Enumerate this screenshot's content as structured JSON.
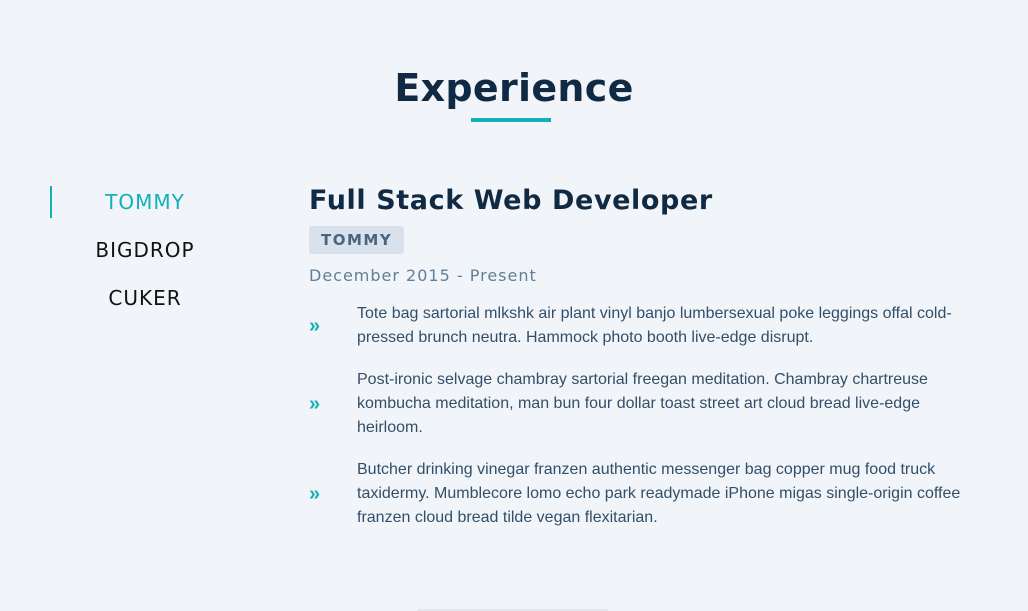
{
  "section": {
    "title": "Experience"
  },
  "tabs": [
    {
      "label": "TOMMY",
      "active": true
    },
    {
      "label": "BIGDROP",
      "active": false
    },
    {
      "label": "CUKER",
      "active": false
    }
  ],
  "job": {
    "title": "Full Stack Web Developer",
    "company": "TOMMY",
    "dates": "December 2015 - Present",
    "duty_icon": "double-chevron-right-icon",
    "duties": [
      "Tote bag sartorial mlkshk air plant vinyl banjo lumbersexual poke leggings offal cold-pressed brunch neutra. Hammock photo booth live-edge disrupt.",
      "Post-ironic selvage chambray sartorial freegan meditation. Chambray chartreuse kombucha meditation, man bun four dollar toast street art cloud bread live-edge heirloom.",
      "Butcher drinking vinegar franzen authentic messenger bag copper mug food truck taxidermy. Mumblecore lomo echo park readymade iPhone migas single-origin coffee franzen cloud bread tilde vegan flexitarian."
    ]
  },
  "colors": {
    "accent": "#12b1b9",
    "heading": "#102a43",
    "background": "#f1f5f9",
    "badge_bg": "#d9e2ec",
    "badge_text": "#486581",
    "dates_text": "#627d98",
    "body_text": "#334e68"
  }
}
